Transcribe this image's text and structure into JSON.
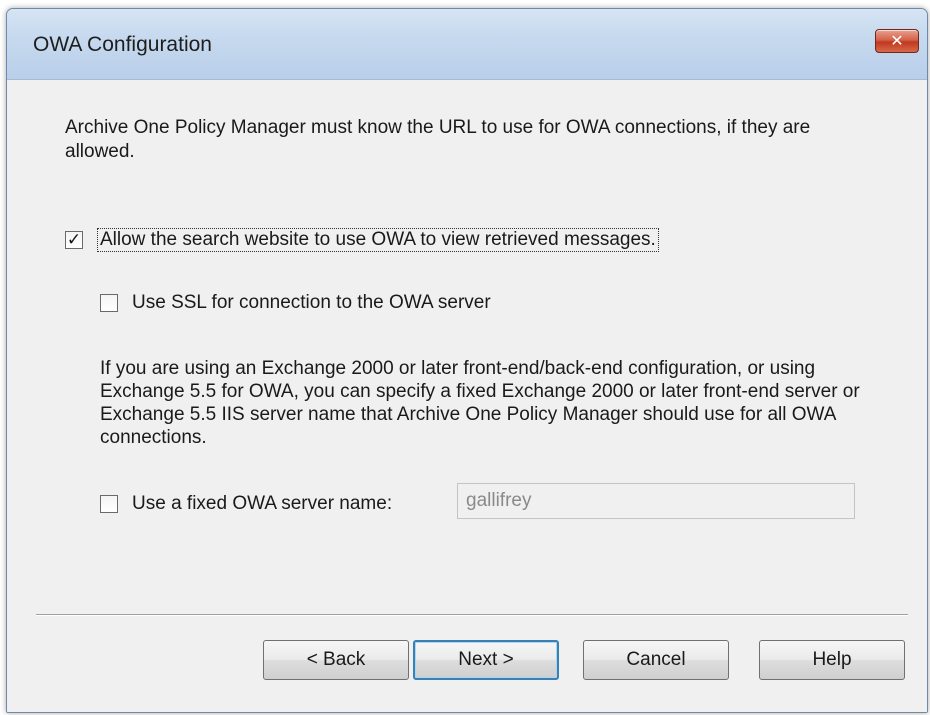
{
  "window": {
    "title": "OWA Configuration",
    "close_glyph": "✕",
    "close_icon": "close-icon"
  },
  "intro_text": "Archive One Policy Manager must know the URL to use for OWA connections, if they are allowed.",
  "options": {
    "allow_owa": {
      "label": "Allow the search website to use OWA to view retrieved messages.",
      "checked": true,
      "check_glyph": "✓"
    },
    "use_ssl": {
      "label": "Use SSL for connection to the OWA server",
      "checked": false,
      "check_glyph": ""
    },
    "fixed_server": {
      "label": "Use a fixed OWA server name:",
      "checked": false,
      "check_glyph": ""
    }
  },
  "exchange_paragraph": "If you are using an Exchange 2000 or later front-end/back-end configuration, or using Exchange 5.5 for OWA, you can specify a fixed Exchange 2000 or later front-end server or Exchange 5.5 IIS server name that Archive One Policy Manager should use for all OWA connections.",
  "server_name_field": {
    "value": "gallifrey",
    "enabled": false
  },
  "buttons": {
    "back": "< Back",
    "next": "Next >",
    "cancel": "Cancel",
    "help": "Help"
  },
  "colors": {
    "titlebar": "#c5d8ee",
    "close_button": "#c1381d",
    "dialog_bg": "#f0f0f0",
    "default_button_border": "#3c7fb1"
  }
}
